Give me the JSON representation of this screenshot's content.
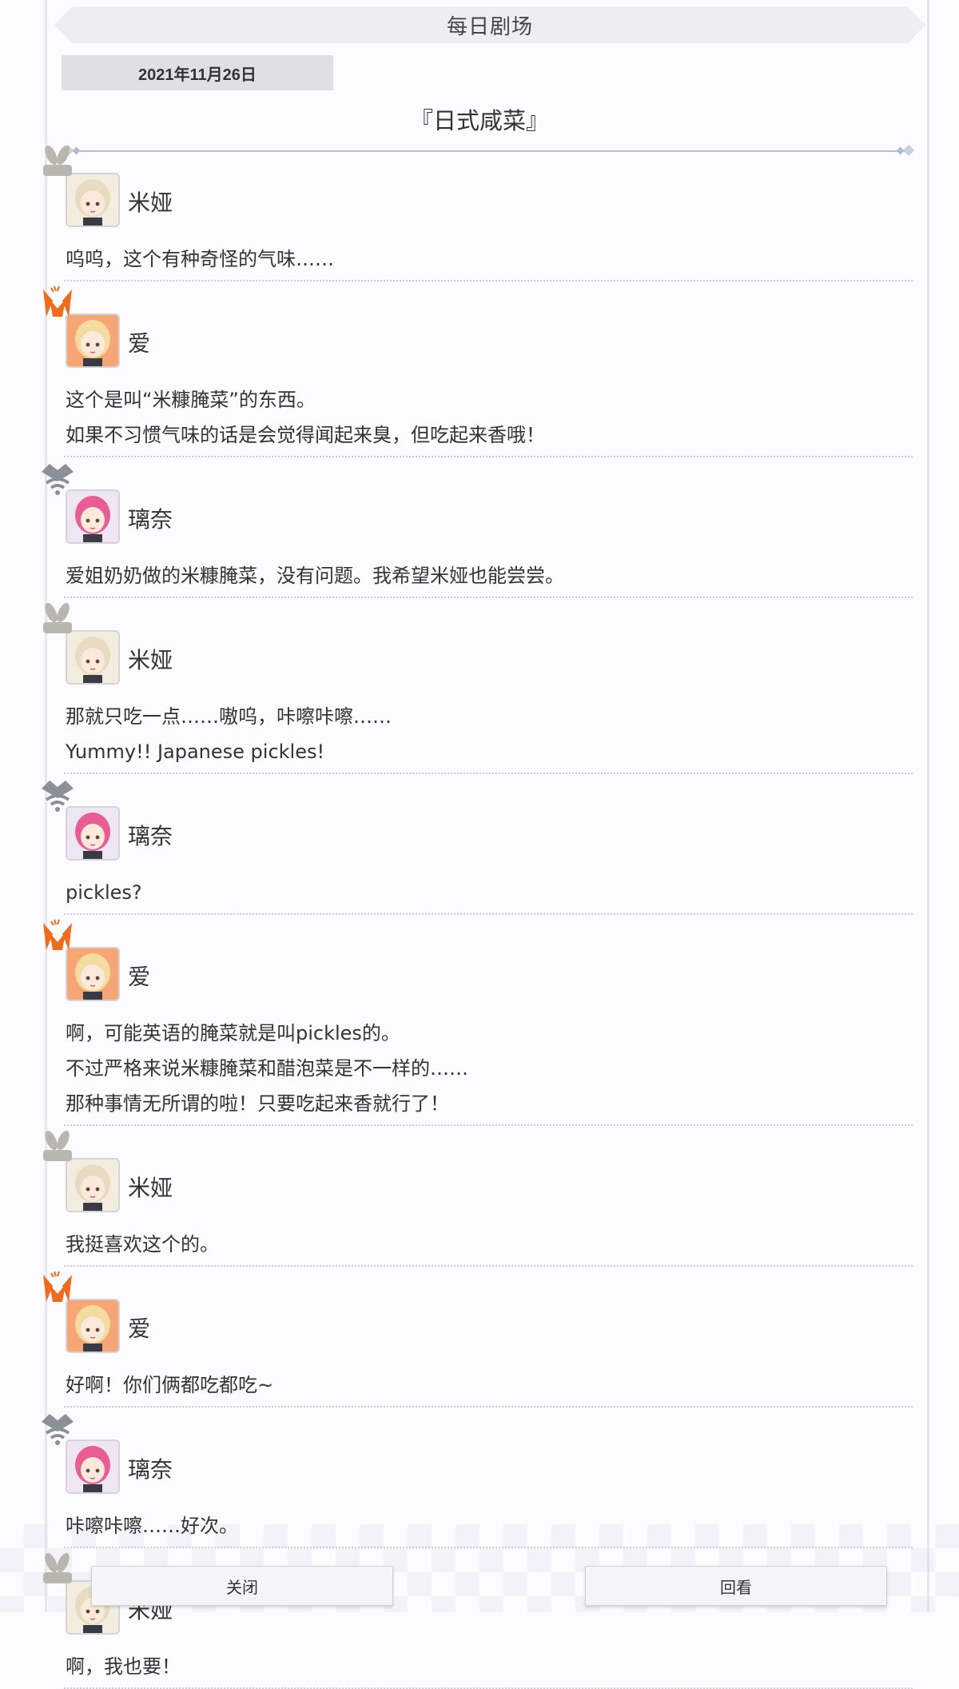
{
  "header": {
    "title": "每日剧场"
  },
  "date": "2021年11月26日",
  "story_title": "『日式咸菜』",
  "characters": {
    "mia": {
      "name": "米娅",
      "avatar_bg": "#f3ede0",
      "hair": "#e8dcc0",
      "stamp": "rabbit-icon",
      "stamp_color": "#b9b6b0"
    },
    "ai": {
      "name": "爱",
      "avatar_bg": "#f6a575",
      "hair": "#f4dca0",
      "stamp": "fox-icon",
      "stamp_color": "#f26a1c"
    },
    "rina": {
      "name": "璃奈",
      "avatar_bg": "#efe6f3",
      "hair": "#e85d94",
      "stamp": "cat-icon",
      "stamp_color": "#8b8f96"
    }
  },
  "messages": [
    {
      "speaker": "米娅",
      "lines": [
        "呜呜，这个有种奇怪的气味……"
      ]
    },
    {
      "speaker": "爱",
      "lines": [
        "这个是叫“米糠腌菜”的东西。",
        "如果不习惯气味的话是会觉得闻起来臭，但吃起来香哦！"
      ]
    },
    {
      "speaker": "璃奈",
      "lines": [
        "爱姐奶奶做的米糠腌菜，没有问题。我希望米娅也能尝尝。"
      ]
    },
    {
      "speaker": "米娅",
      "lines": [
        "那就只吃一点……嗷呜，咔嚓咔嚓……",
        "Yummy!! Japanese pickles!"
      ]
    },
    {
      "speaker": "璃奈",
      "lines": [
        "pickles?"
      ]
    },
    {
      "speaker": "爱",
      "lines": [
        "啊，可能英语的腌菜就是叫pickles的。",
        "不过严格来说米糠腌菜和醋泡菜是不一样的……",
        "那种事情无所谓的啦！只要吃起来香就行了！"
      ]
    },
    {
      "speaker": "米娅",
      "lines": [
        "我挺喜欢这个的。"
      ]
    },
    {
      "speaker": "爱",
      "lines": [
        "好啊！你们俩都吃都吃~"
      ]
    },
    {
      "speaker": "璃奈",
      "lines": [
        "咔嚓咔嚓……好次。"
      ]
    },
    {
      "speaker": "米娅",
      "lines": [
        "啊，我也要！"
      ]
    }
  ],
  "buttons": {
    "close": "关闭",
    "replay": "回看"
  }
}
